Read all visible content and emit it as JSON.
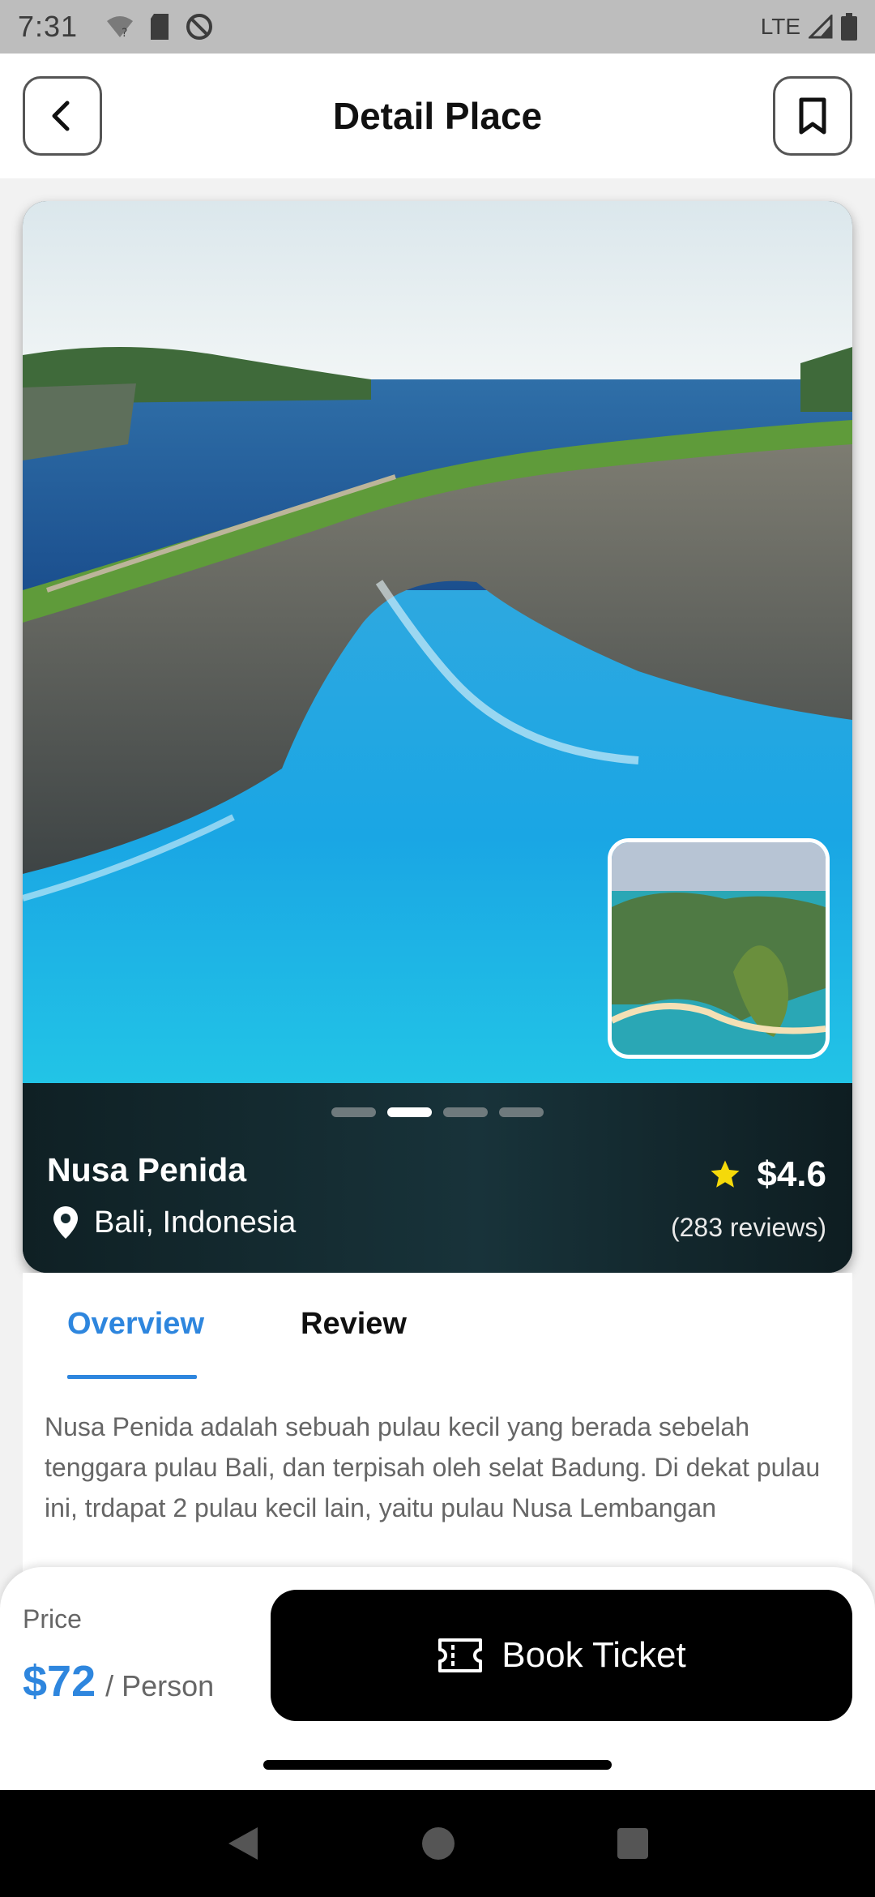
{
  "status_bar": {
    "time": "7:31",
    "network": "LTE"
  },
  "header": {
    "title": "Detail Place"
  },
  "place": {
    "name": "Nusa Penida",
    "location": "Bali, Indonesia",
    "rating": "$4.6",
    "reviews": "(283 reviews)",
    "carousel": {
      "count": 4,
      "active_index": 1
    }
  },
  "tabs": [
    {
      "label": "Overview",
      "active": true
    },
    {
      "label": "Review",
      "active": false
    }
  ],
  "description": "Nusa Penida adalah sebuah pulau kecil yang berada sebelah tenggara pulau Bali, dan terpisah oleh selat Badung. Di dekat pulau ini, trdapat 2 pulau kecil lain, yaitu pulau Nusa Lembangan",
  "footer": {
    "price_label": "Price",
    "price": "$72",
    "price_unit": "/ Person",
    "book_label": "Book Ticket"
  },
  "colors": {
    "accent": "#2e86de",
    "star": "#f5d90a",
    "button": "#000000"
  },
  "icons": [
    "back-arrow-icon",
    "bookmark-icon",
    "location-pin-icon",
    "star-icon",
    "ticket-icon",
    "nav-back-icon",
    "nav-home-icon",
    "nav-recents-icon"
  ]
}
